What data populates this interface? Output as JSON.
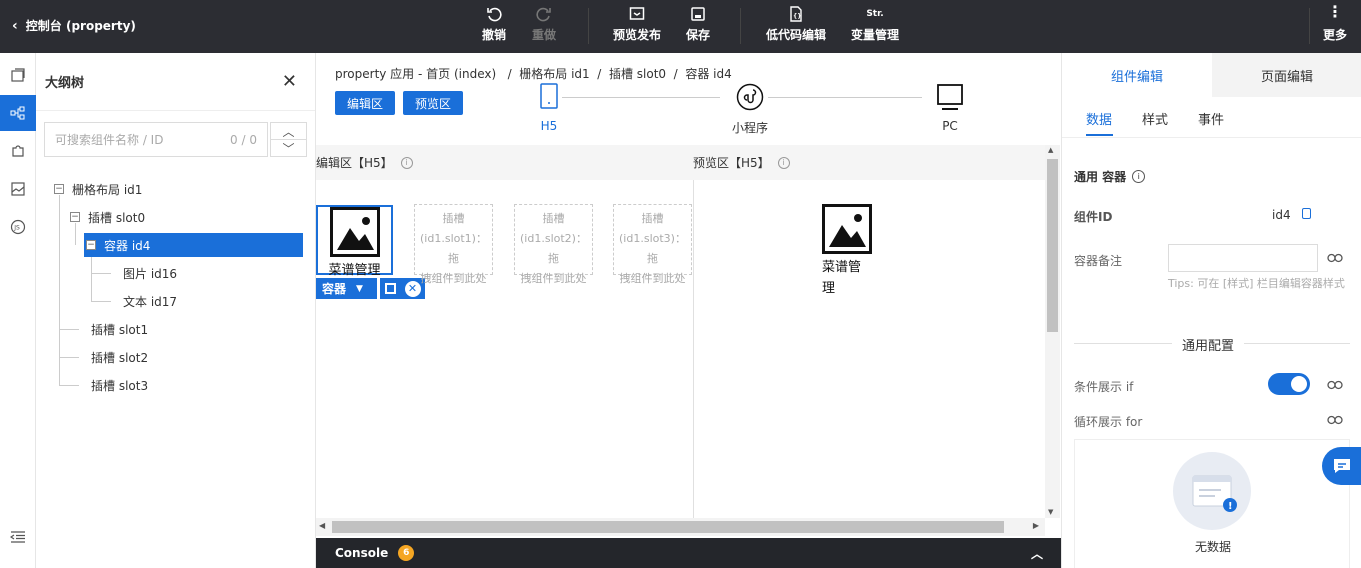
{
  "topbar": {
    "title": "控制台 (property)",
    "undo": "撤销",
    "redo": "重做",
    "preview_publish": "预览发布",
    "save": "保存",
    "lowcode_edit": "低代码编辑",
    "var_manage": "变量管理",
    "var_icon_text": "Str.",
    "more": "更多"
  },
  "outline": {
    "title": "大纲树",
    "search_placeholder": "可搜索组件名称 / ID",
    "search_count": "0 / 0",
    "tree": [
      {
        "label": "栅格布局 id1"
      },
      {
        "label": "插槽 slot0"
      },
      {
        "label": "容器 id4"
      },
      {
        "label": "图片 id16"
      },
      {
        "label": "文本 id17"
      },
      {
        "label": "插槽 slot1"
      },
      {
        "label": "插槽 slot2"
      },
      {
        "label": "插槽 slot3"
      }
    ]
  },
  "center": {
    "breadcrumb": "property 应用 - 首页 (index)   /  栅格布局 id1  /  插槽 slot0  /  容器 id4",
    "edit_btn": "编辑区",
    "preview_btn": "预览区",
    "devices": [
      "H5",
      "小程序",
      "PC"
    ],
    "edit_header": "编辑区【H5】",
    "preview_header": "预览区【H5】",
    "component_text": "菜谱管理",
    "preview_text_1": "菜谱管",
    "preview_text_2": "理",
    "container_tag": "容器",
    "slots": [
      {
        "line1": "插槽",
        "line2": "(id1.slot1)：拖",
        "line3": "拽组件到此处"
      },
      {
        "line1": "插槽",
        "line2": "(id1.slot2)：拖",
        "line3": "拽组件到此处"
      },
      {
        "line1": "插槽",
        "line2": "(id1.slot3)：拖",
        "line3": "拽组件到此处"
      }
    ],
    "console_label": "Console",
    "console_count": "6"
  },
  "right": {
    "tab_component": "组件编辑",
    "tab_page": "页面编辑",
    "subtab_data": "数据",
    "subtab_style": "样式",
    "subtab_event": "事件",
    "general_container": "通用 容器",
    "component_id_label": "组件ID",
    "component_id_value": "id4",
    "container_note_label": "容器备注",
    "tips": "Tips: 可在 [样式] 栏目编辑容器样式",
    "general_config": "通用配置",
    "cond_show": "条件展示 if",
    "loop_show": "循环展示 for",
    "no_data": "无数据"
  },
  "colors": {
    "accent": "#1a6fd9",
    "topbar": "#2c2d33",
    "console_badge": "#f5a623"
  }
}
